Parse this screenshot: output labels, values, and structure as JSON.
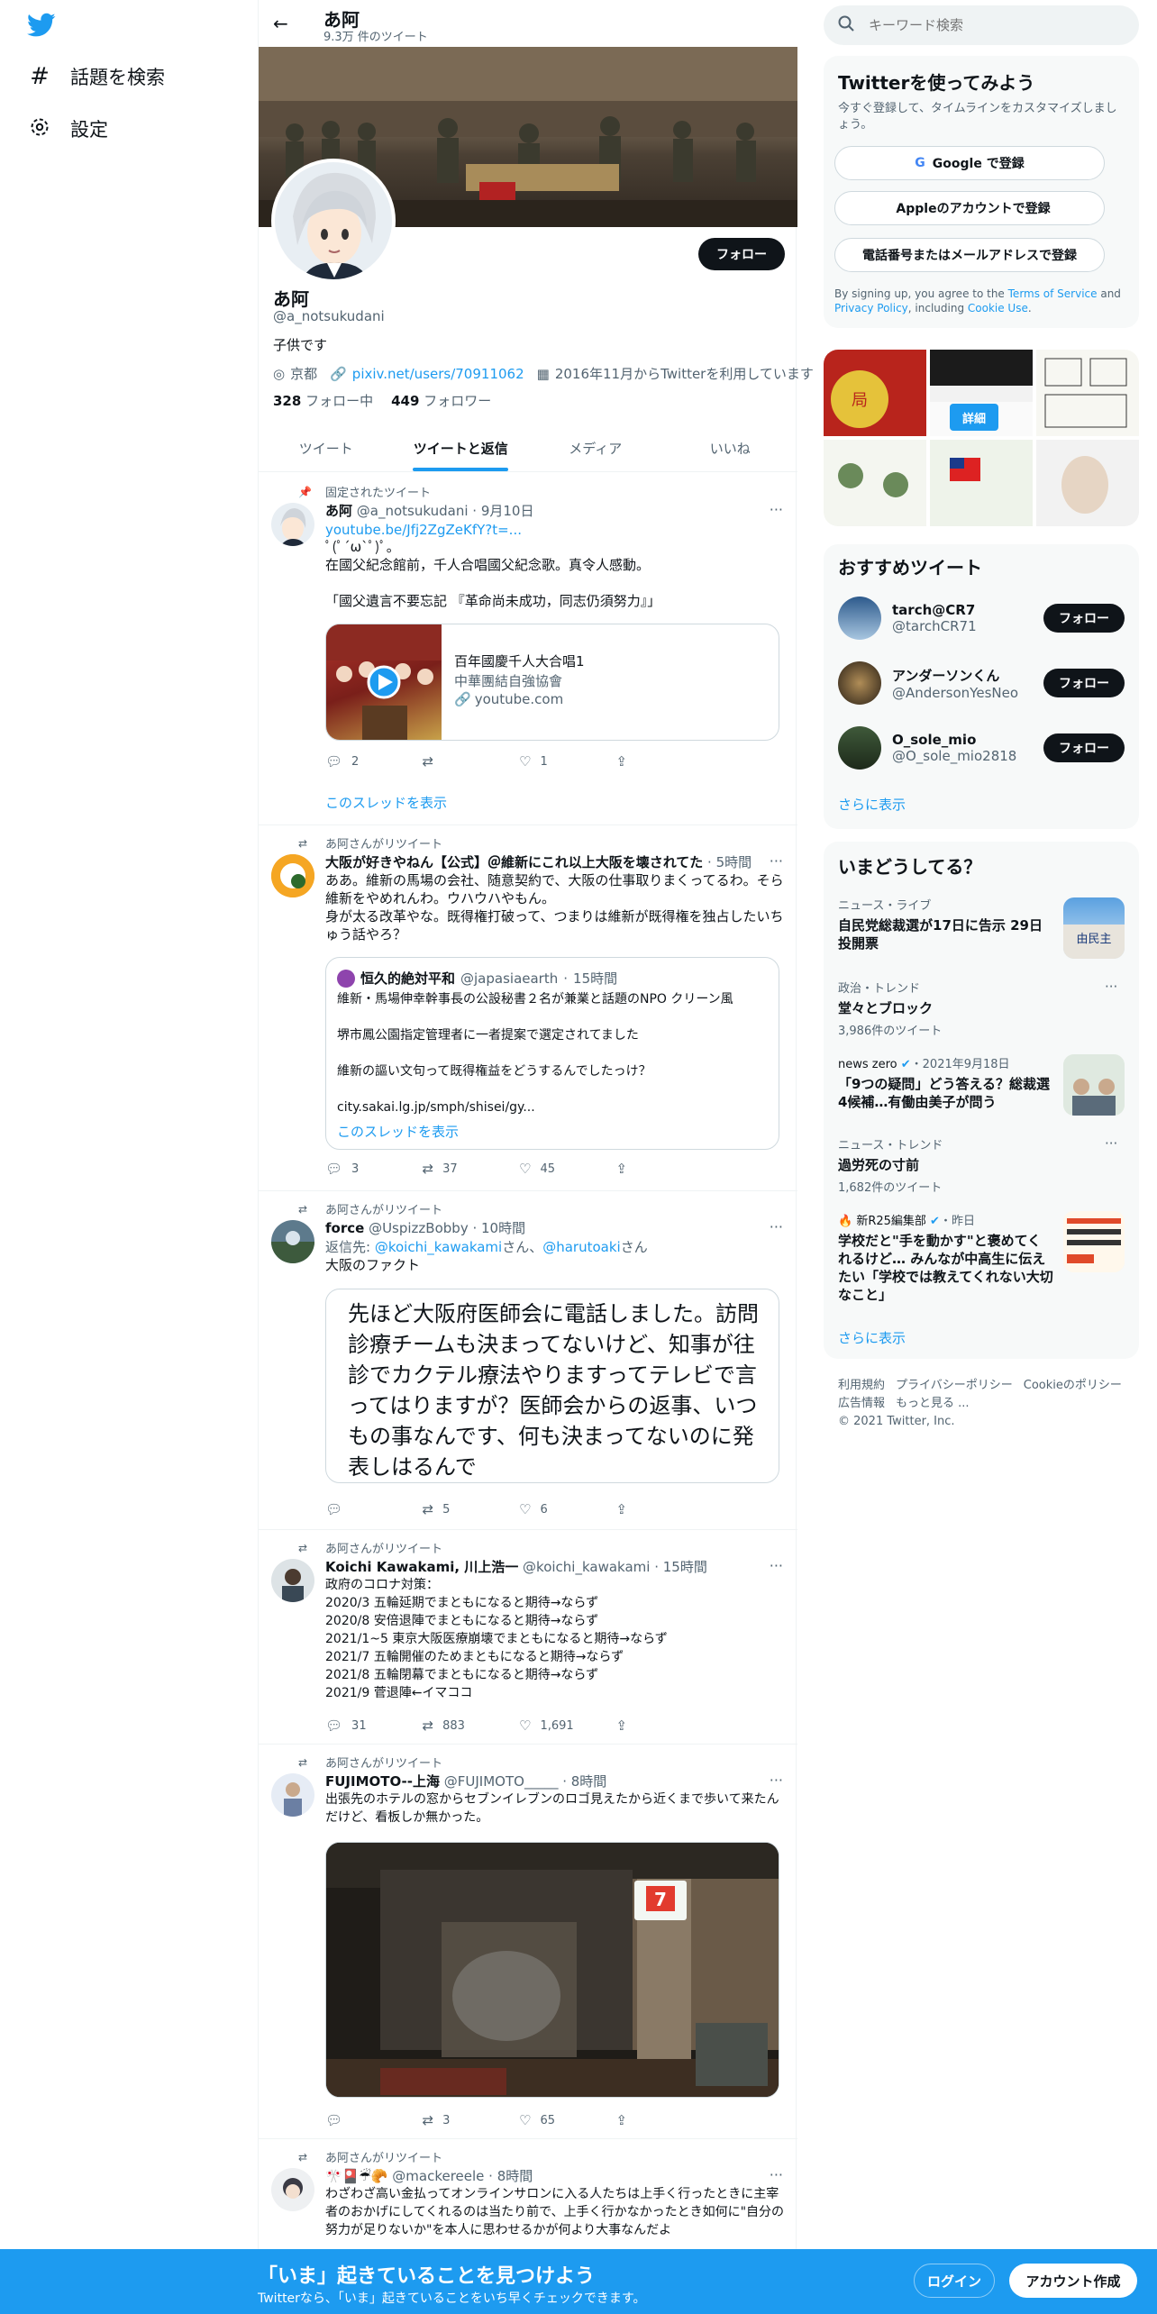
{
  "nav": {
    "explore_label": "話題を検索",
    "settings_label": "設定"
  },
  "header": {
    "title": "あ阿",
    "tweet_count": "9.3万 件のツイート"
  },
  "profile": {
    "name": "あ阿",
    "handle": "@a_notsukudani",
    "bio": "子供です",
    "location": "京都",
    "link": "pixiv.net/users/70911062",
    "joined": "2016年11月からTwitterを利用しています",
    "following_count": "328",
    "following_label": "フォロー中",
    "followers_count": "449",
    "followers_label": "フォロワー",
    "follow_button": "フォロー"
  },
  "tabs": [
    "ツイート",
    "ツイートと返信",
    "メディア",
    "いいね"
  ],
  "tweets": [
    {
      "context": "固定されたツイート",
      "name": "あ阿",
      "handle": "@a_notsukudani",
      "time": "9月10日",
      "link": "youtube.be/Jfj2ZgZeKfY?t=...",
      "text": "ﾟ(ﾟ´ω`ﾟ)ﾟ。\n在國父紀念館前，千人合唱國父紀念歌。真令人感動。\n\n「國父遺言不要忘記 『革命尚未成功，同志仍須努力』」",
      "card_title": "百年國慶千人大合唱1",
      "card_desc": "中華團結自強協會",
      "card_domain": "youtube.com",
      "replies": "2",
      "retweets": "",
      "likes": "1",
      "show_thread": "このスレッドを表示"
    },
    {
      "context": "あ阿さんがリツイート",
      "name": "大阪が好きやねん【公式】＠維新にこれ以上大阪を壊されてた",
      "handle": "",
      "time": "5時間",
      "text": "ああ。維新の馬場の会社、随意契約で、大阪の仕事取りまくってるわ。そら維新をやめれんわ。ウハウハやもん。\n身が太る改革やな。既得権打破って、つまりは維新が既得権を独占したいちゅう話やろ？",
      "quote_name": "恒久的絶対平和",
      "quote_handle": "@japasiaearth",
      "quote_time": "15時間",
      "quote_text": "維新・馬場伸幸幹事長の公設秘書２名が兼業と話題のNPO クリーン風\n\n堺市鳳公園指定管理者に一者提案で選定されてました\n\n維新の謳い文句って既得権益をどうするんでしたっけ？\n\ncity.sakai.lg.jp/smph/shisei/gy...",
      "quote_thread": "このスレッドを表示",
      "replies": "3",
      "retweets": "37",
      "likes": "45"
    },
    {
      "context": "あ阿さんがリツイート",
      "name": "force",
      "handle": "@UspizzBobby",
      "time": "10時間",
      "reply_prefix": "返信先: ",
      "reply_to_1": "@koichi_kawakami",
      "reply_mid": "さん、",
      "reply_to_2": "@harutoaki",
      "reply_suffix": "さん",
      "text": "大阪のファクト",
      "image_text": "先ほど大阪府医師会に電話しました。訪問診療チームも決まってないけど、知事が往診でカクテル療法やりますってテレビで言ってはりますが？医師会からの返事、いつもの事なんです、何も決まってないのに発表しはるんで",
      "replies": "",
      "retweets": "5",
      "likes": "6"
    },
    {
      "context": "あ阿さんがリツイート",
      "name": "Koichi Kawakami, 川上浩一",
      "handle": "@koichi_kawakami",
      "time": "15時間",
      "text": "政府のコロナ対策：\n2020/3 五輪延期でまともになると期待→ならず\n2020/8 安倍退陣でまともになると期待→ならず\n2021/1~5 東京大阪医療崩壊でまともになると期待→ならず\n2021/7 五輪開催のためまともになると期待→ならず\n2021/8 五輪閉幕でまともになると期待→ならず\n2021/9 菅退陣←イマココ",
      "replies": "31",
      "retweets": "883",
      "likes": "1,691"
    },
    {
      "context": "あ阿さんがリツイート",
      "name": "FUJIMOTO--上海",
      "handle": "@FUJIMOTO_____",
      "time": "8時間",
      "text": "出張先のホテルの窓からセブンイレブンのロゴ見えたから近くまで歩いて来たんだけど、看板しか無かった。",
      "replies": "",
      "retweets": "3",
      "likes": "65"
    },
    {
      "context": "あ阿さんがリツイート",
      "name": "🎌🎴☔🥐",
      "handle": "@mackereele",
      "time": "8時間",
      "text": "わざわざ高い金払ってオンラインサロンに入る人たちは上手く行ったときに主宰者のおかげにしてくれるのは当たり前で、上手く行かなかったとき如何に\"自分の努力が足りないか\"を本人に思わせるかが何より大事なんだよ"
    }
  ],
  "search": {
    "placeholder": "キーワード検索"
  },
  "signup": {
    "title": "Twitterを使ってみよう",
    "subtitle": "今すぐ登録して、タイムラインをカスタマイズしましょう。",
    "google": "Google で登録",
    "apple": "Appleのアカウントで登録",
    "phone": "電話番号またはメールアドレスで登録",
    "terms_pre": "By signing up, you agree to the ",
    "terms_tos": "Terms of Service",
    "terms_and": " and ",
    "terms_privacy": "Privacy Policy",
    "terms_incl": ", including ",
    "terms_cookie": "Cookie Use",
    "terms_end": "."
  },
  "media_grid": {
    "detail_button": "詳細"
  },
  "recommended": {
    "title": "おすすめツイート",
    "users": [
      {
        "name": "tarch@CR7",
        "handle": "@tarchCR71",
        "button": "フォロー"
      },
      {
        "name": "アンダーソンくん",
        "handle": "@AndersonYesNeo",
        "button": "フォロー"
      },
      {
        "name": "O_sole_mio",
        "handle": "@O_sole_mio2818",
        "button": "フォロー"
      }
    ],
    "show_more": "さらに表示"
  },
  "trends": {
    "title": "いまどうしてる？",
    "items": [
      {
        "category": "ニュース・ライブ",
        "title": "自民党総裁選が17日に告示 29日投開票",
        "count": ""
      },
      {
        "category": "政治・トレンド",
        "title": "堂々とブロック",
        "count": "3,986件のツイート"
      },
      {
        "category": "news zero",
        "extra": "・2021年9月18日",
        "title": "「9つの疑問」どう答える？総裁選4候補…有働由美子が問う",
        "count": ""
      },
      {
        "category": "ニュース・トレンド",
        "title": "過労死の寸前",
        "count": "1,682件のツイート"
      },
      {
        "category": "新R25編集部",
        "extra": "・昨日",
        "title": "学校だと\"手を動かす\"と褒めてくれるけど… みんなが中高生に伝えたい「学校では教えてくれない大切なこと」",
        "count": ""
      }
    ],
    "show_more": "さらに表示"
  },
  "footer": {
    "links": [
      "利用規約",
      "プライバシーポリシー",
      "Cookieのポリシー",
      "広告情報",
      "もっと見る ..."
    ],
    "copyright": "© 2021 Twitter, Inc."
  },
  "bottom_bar": {
    "title": "「いま」起きていることを見つけよう",
    "subtitle": "Twitterなら、「いま」起きていることをいち早くチェックできます。",
    "login": "ログイン",
    "signup": "アカウント作成"
  },
  "colors": {
    "accent": "#1d9bf0",
    "text": "#0f1419",
    "muted": "#536471",
    "border": "#eff3f4"
  }
}
